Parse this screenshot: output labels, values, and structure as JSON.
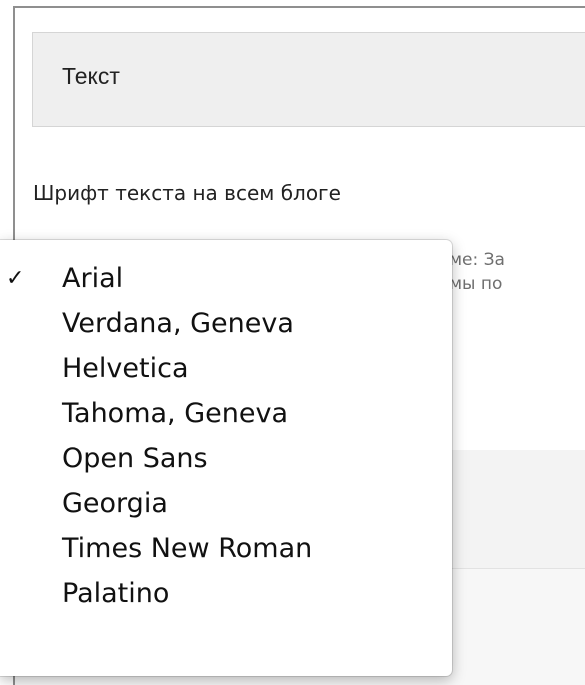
{
  "section": {
    "header_label": "Текст"
  },
  "font_field": {
    "label": "Шрифт текста на всем блоге",
    "selected": "Arial",
    "options": [
      "Arial",
      "Verdana, Geneva",
      "Helvetica",
      "Tahoma, Geneva",
      "Open Sans",
      "Georgia",
      "Times New Roman",
      "Palatino"
    ],
    "help_line_1": "роме: За",
    "help_line_2": "ормы по"
  },
  "icons": {
    "selected_marker": "checkmark-icon",
    "check_glyph": "✓"
  },
  "colors": {
    "focus_border": "#6aa6df",
    "header_bg": "#efefef",
    "menu_bg": "#ffffff"
  }
}
